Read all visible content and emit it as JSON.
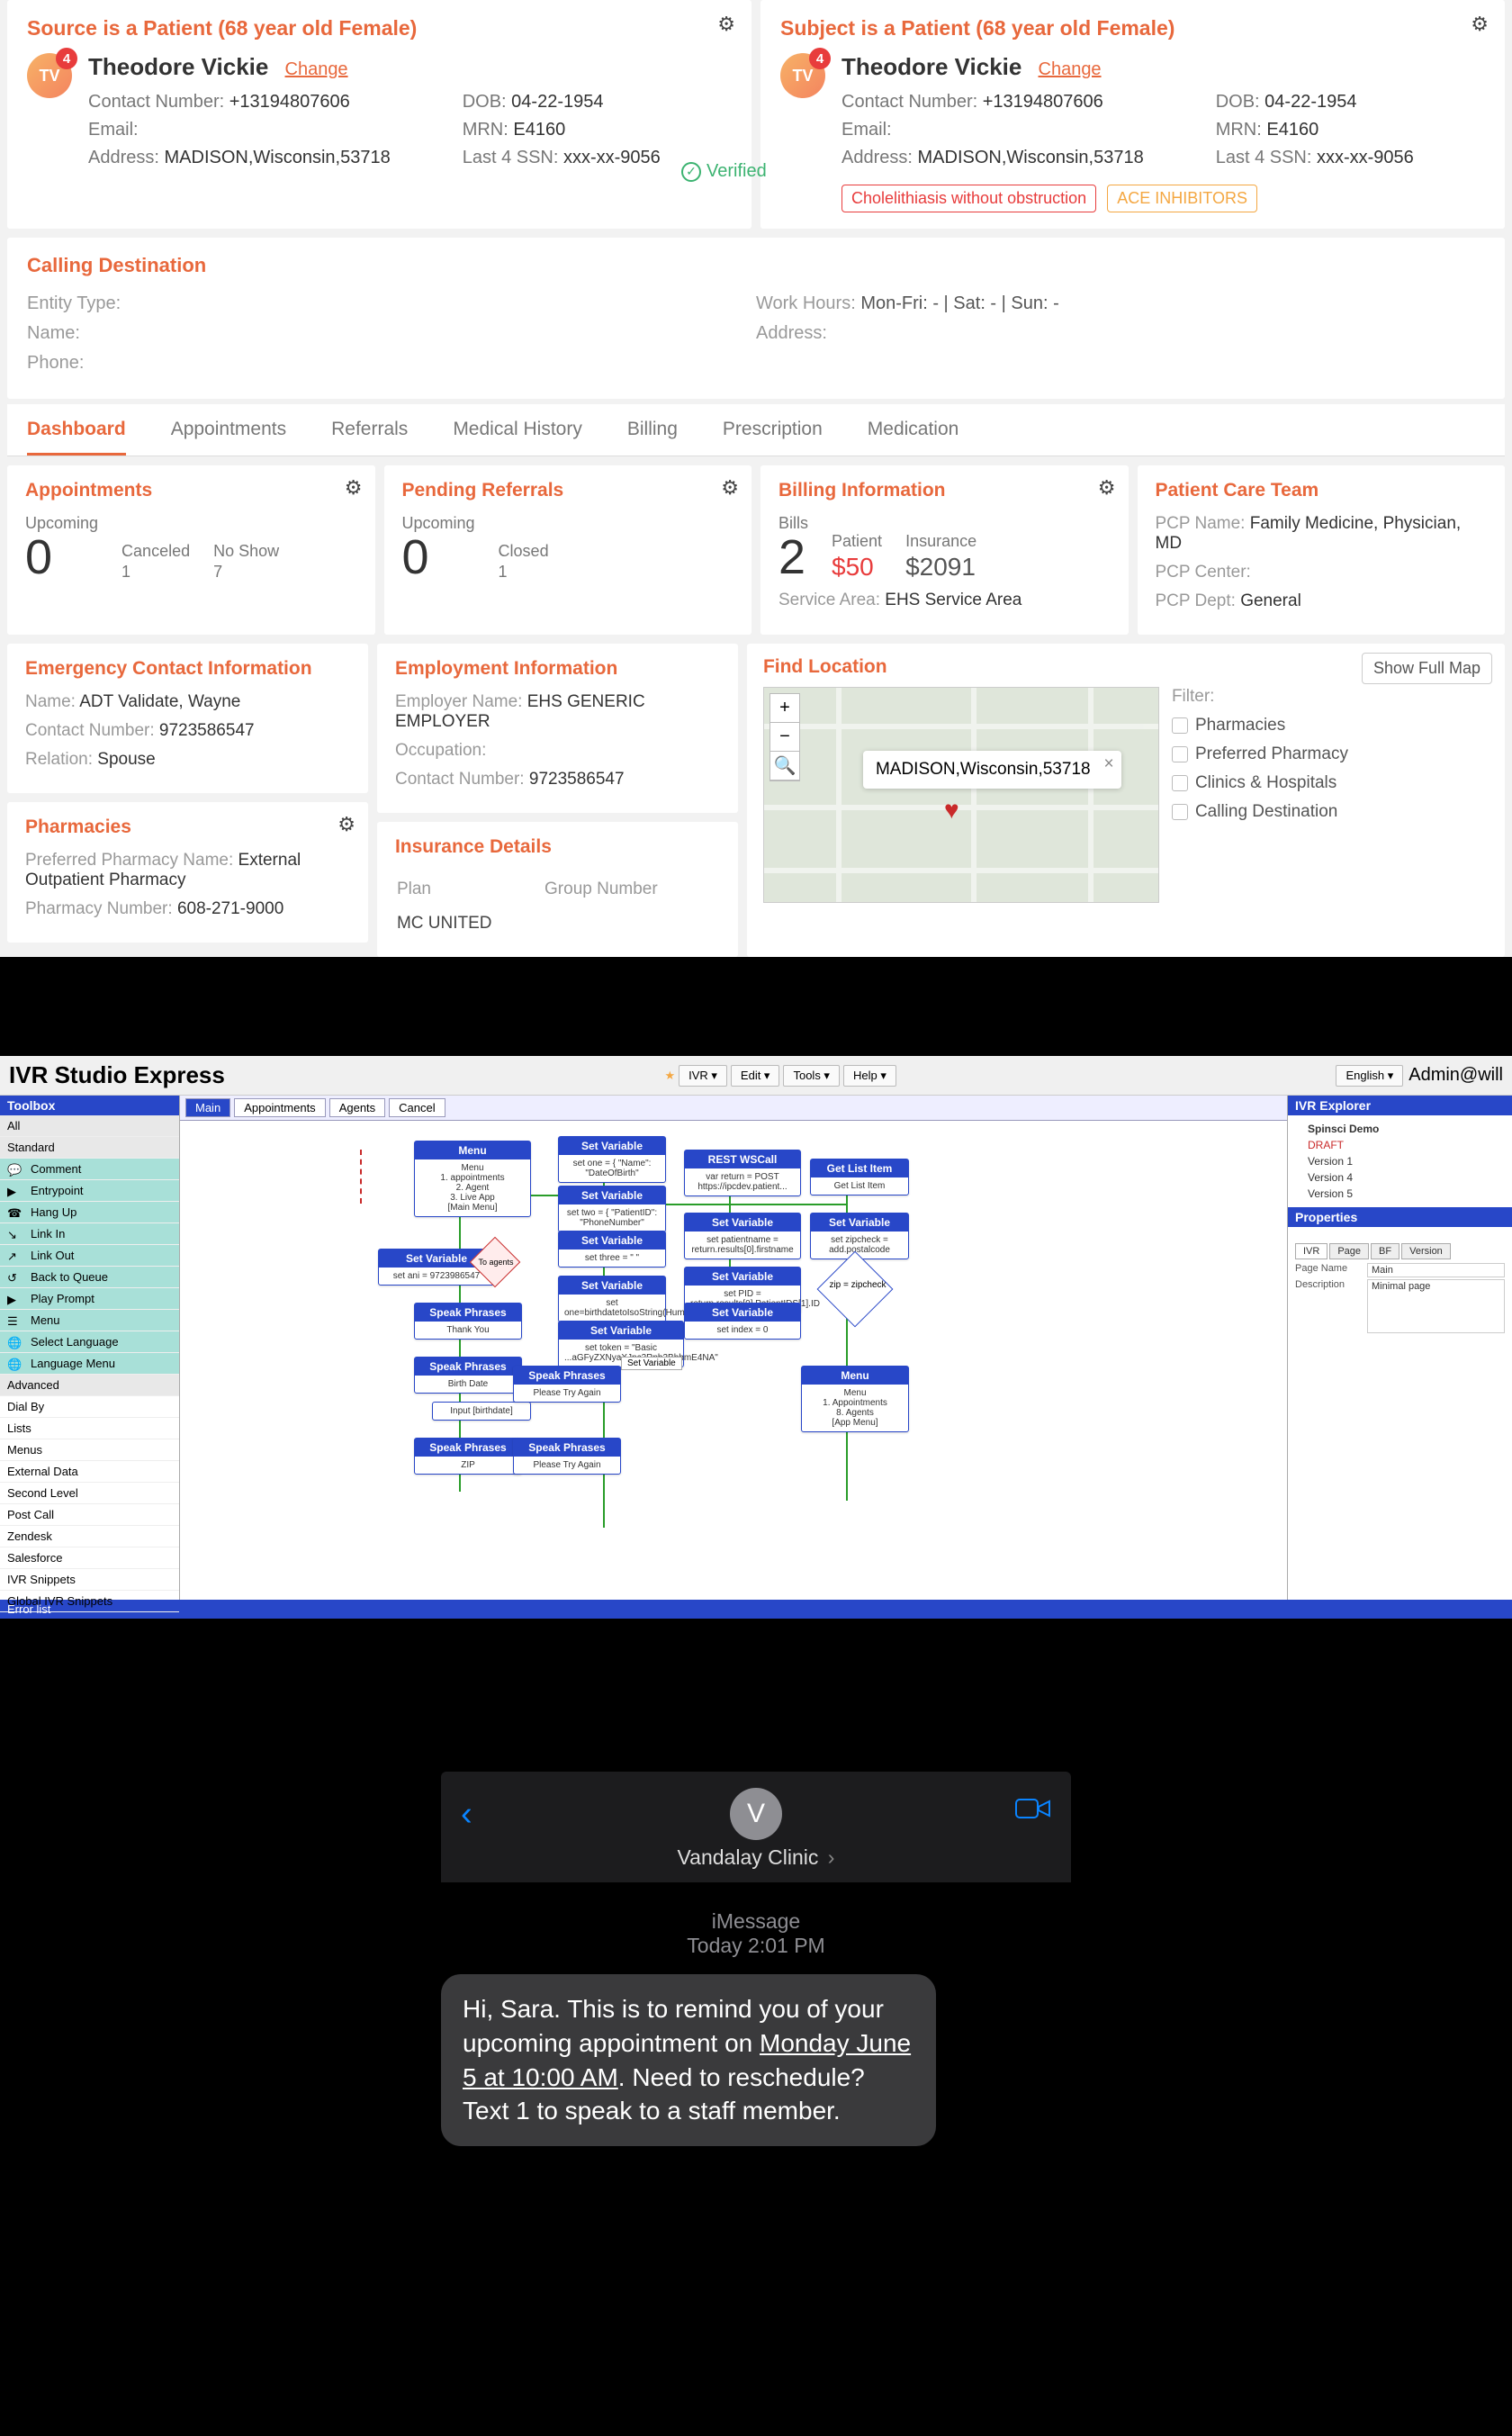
{
  "dashboard": {
    "source": {
      "title": "Source is a Patient (68 year old Female)",
      "initials": "TV",
      "badge": "4",
      "name": "Theodore Vickie",
      "change": "Change",
      "contact_lbl": "Contact Number:",
      "contact": "+13194807606",
      "email_lbl": "Email:",
      "email": "",
      "address_lbl": "Address:",
      "address": "MADISON,Wisconsin,53718",
      "dob_lbl": "DOB:",
      "dob": "04-22-1954",
      "mrn_lbl": "MRN:",
      "mrn": "E4160",
      "ssn_lbl": "Last 4 SSN:",
      "ssn": "xxx-xx-9056"
    },
    "subject": {
      "title": "Subject is a Patient (68 year old Female)",
      "initials": "TV",
      "badge": "4",
      "name": "Theodore Vickie",
      "change": "Change",
      "contact_lbl": "Contact Number:",
      "contact": "+13194807606",
      "email_lbl": "Email:",
      "email": "",
      "address_lbl": "Address:",
      "address": "MADISON,Wisconsin,53718",
      "dob_lbl": "DOB:",
      "dob": "04-22-1954",
      "mrn_lbl": "MRN:",
      "mrn": "E4160",
      "ssn_lbl": "Last 4 SSN:",
      "ssn": "xxx-xx-9056",
      "verified": "Verified",
      "pill1": "Cholelithiasis without obstruction",
      "pill2": "ACE INHIBITORS"
    },
    "dest": {
      "title": "Calling Destination",
      "entity_lbl": "Entity Type:",
      "name_lbl": "Name:",
      "phone_lbl": "Phone:",
      "hours_lbl": "Work Hours:",
      "hours": "Mon-Fri: - | Sat: - | Sun: -",
      "addr_lbl": "Address:"
    },
    "tabs": [
      "Dashboard",
      "Appointments",
      "Referrals",
      "Medical History",
      "Billing",
      "Prescription",
      "Medication"
    ],
    "active_tab": 0,
    "appts": {
      "title": "Appointments",
      "upcoming_lbl": "Upcoming",
      "upcoming": "0",
      "canceled_lbl": "Canceled",
      "canceled": "1",
      "noshow_lbl": "No Show",
      "noshow": "7"
    },
    "referrals": {
      "title": "Pending Referrals",
      "upcoming_lbl": "Upcoming",
      "upcoming": "0",
      "closed_lbl": "Closed",
      "closed": "1"
    },
    "billing": {
      "title": "Billing Information",
      "bills_lbl": "Bills",
      "bills": "2",
      "patient_lbl": "Patient",
      "patient": "$50",
      "insurance_lbl": "Insurance",
      "insurance": "$2091",
      "area_lbl": "Service Area:",
      "area": "EHS Service Area"
    },
    "care": {
      "title": "Patient Care Team",
      "pcp_name_lbl": "PCP Name:",
      "pcp_name": "Family Medicine, Physician, MD",
      "pcp_center_lbl": "PCP Center:",
      "pcp_center": "",
      "pcp_dept_lbl": "PCP Dept:",
      "pcp_dept": "General"
    },
    "emerg": {
      "title": "Emergency Contact Information",
      "name_lbl": "Name:",
      "name": "ADT Validate, Wayne",
      "num_lbl": "Contact Number:",
      "num": "9723586547",
      "rel_lbl": "Relation:",
      "rel": "Spouse"
    },
    "employ": {
      "title": "Employment Information",
      "emp_lbl": "Employer Name:",
      "emp": "EHS GENERIC EMPLOYER",
      "occ_lbl": "Occupation:",
      "occ": "",
      "num_lbl": "Contact Number:",
      "num": "9723586547"
    },
    "pharm": {
      "title": "Pharmacies",
      "pref_lbl": "Preferred Pharmacy Name:",
      "pref": "External Outpatient Pharmacy",
      "num_lbl": "Pharmacy Number:",
      "num": "608-271-9000"
    },
    "ins": {
      "title": "Insurance Details",
      "plan_lbl": "Plan",
      "group_lbl": "Group Number",
      "plan": "MC UNITED"
    },
    "map": {
      "title": "Find Location",
      "show": "Show Full Map",
      "popup": "MADISON,Wisconsin,53718",
      "filter_lbl": "Filter:",
      "filters": [
        "Pharmacies",
        "Preferred Pharmacy",
        "Clinics & Hospitals",
        "Calling Destination"
      ]
    }
  },
  "ivr": {
    "title": "IVR Studio Express",
    "menu": [
      "IVR ▾",
      "Edit ▾",
      "Tools ▾",
      "Help ▾"
    ],
    "lang": "English ▾",
    "user": "Admin@will",
    "toolbox_title": "Toolbox",
    "cats": {
      "all": "All",
      "std": "Standard"
    },
    "tools": [
      "Comment",
      "Entrypoint",
      "Hang Up",
      "Link In",
      "Link Out",
      "Back to Queue",
      "Play Prompt",
      "Menu",
      "Select Language",
      "Language Menu"
    ],
    "adv_title": "Advanced",
    "advs": [
      "Dial By",
      "Lists",
      "Menus",
      "External Data",
      "Second Level",
      "Post Call",
      "Zendesk",
      "Salesforce",
      "IVR Snippets",
      "Global IVR Snippets"
    ],
    "canvas_tabs": [
      "Main",
      "Appointments",
      "Agents",
      "Cancel"
    ],
    "nodes": {
      "menu1": {
        "h": "Menu",
        "b": "Menu\n1. appointments\n2. Agent\n3. Live App\n[Main Menu]"
      },
      "setvar1": {
        "h": "Set Variable",
        "b": "set ani = 9723986547"
      },
      "speak1": {
        "h": "Speak Phrases",
        "b": "Thank You"
      },
      "speak_bd": {
        "h": "Speak Phrases",
        "b": "Birth Date"
      },
      "input_bd": {
        "b": "Input [birthdate]"
      },
      "speak_zip": {
        "h": "Speak Phrases",
        "b": "ZIP"
      },
      "setvar_top": {
        "h": "Set Variable",
        "b": "set one = { \"Name\": \"DateOfBirth\""
      },
      "setvar2": {
        "h": "Set Variable",
        "b": "set two = { \"PatientID\": \"PhoneNumber\""
      },
      "setvar3": {
        "h": "Set Variable",
        "b": "set three = \" \""
      },
      "setvar4": {
        "h": "Set Variable",
        "b": "set one=birthdatetoIsoString(Human).ToString"
      },
      "setvar5": {
        "h": "Set Variable",
        "b": "set token = \"Basic ...aGFyZXNyaXJpc3Rpb3BhbmE4NA\""
      },
      "speak_try": {
        "h": "Speak Phrases",
        "b": "Please Try Again"
      },
      "speak_try2": {
        "h": "Speak Phrases",
        "b": "Please Try Again"
      },
      "rest": {
        "h": "REST WSCall",
        "b": "var return = POST https://ipcdev.patient..."
      },
      "setvar_pn": {
        "h": "Set Variable",
        "b": "set patientname = return.results[0].firstname"
      },
      "setvar_pid": {
        "h": "Set Variable",
        "b": "set PID = return.results[0].PatientIDS[1].ID"
      },
      "setvar_idx": {
        "h": "Set Variable",
        "b": "set index = 0"
      },
      "getlist": {
        "h": "Get List Item",
        "b": "Get List Item"
      },
      "setvar_zip": {
        "h": "Set Variable",
        "b": "set zipcheck = add.postalcode"
      },
      "diamond": {
        "b": "zip = zipcheck"
      },
      "menu2": {
        "h": "Menu",
        "b": "Menu\n1. Appointments\n8. Agents\n[App Menu]"
      },
      "toagents": "To agents",
      "setvarbtn": "Set Variable"
    },
    "explorer": {
      "title": "IVR Explorer",
      "root": "Spinsci Demo",
      "items": [
        "DRAFT",
        "Version 1",
        "Version 4",
        "Version 5"
      ]
    },
    "props": {
      "title": "Properties",
      "tabs": [
        "IVR",
        "Page",
        "BF",
        "Version"
      ],
      "page_name_lbl": "Page Name",
      "page_name": "Main",
      "desc_lbl": "Description",
      "desc": "Minimal page"
    },
    "errlist": "Error list"
  },
  "imsg": {
    "avatar": "V",
    "name": "Vandalay Clinic",
    "meta1": "iMessage",
    "meta2": "Today 2:01 PM",
    "bubble_pre": "Hi, Sara. This is to remind you of your upcoming appointment on ",
    "bubble_u": "Monday June 5 at 10:00 AM",
    "bubble_post": ". Need to reschedule? Text 1 to speak to a staff member."
  }
}
